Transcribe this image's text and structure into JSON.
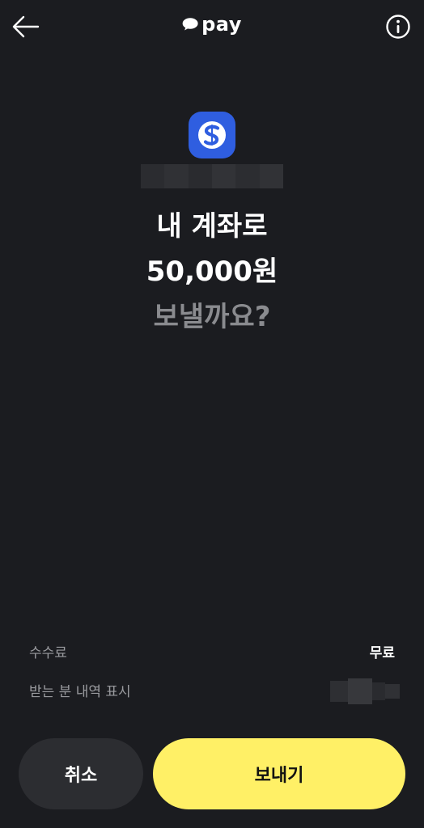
{
  "header": {
    "brand": "pay",
    "back_icon": "arrow-left-icon",
    "info_icon": "info-icon"
  },
  "bank": {
    "icon": "shinhan-bank-icon",
    "color": "#2f5ee0"
  },
  "confirm": {
    "line1": "내 계좌로",
    "amount": "50,000원",
    "question": "보낼까요?"
  },
  "details": {
    "fee_label": "수수료",
    "fee_value": "무료",
    "recipient_label": "받는 분 내역 표시"
  },
  "actions": {
    "cancel_label": "취소",
    "send_label": "보내기"
  },
  "colors": {
    "background": "#1b1c20",
    "accent_yellow": "#fff066",
    "secondary_button": "#2c2d31",
    "muted_text": "#8a8b8f"
  }
}
